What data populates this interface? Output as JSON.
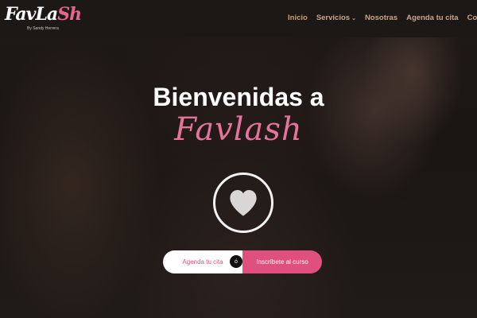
{
  "logo": {
    "word_main": "FavLa",
    "word_accent": "Sh",
    "tagline": "By Sandy Herrera"
  },
  "nav": {
    "items": [
      {
        "label": "Inicio"
      },
      {
        "label": "Servicios",
        "caret": "⌄"
      },
      {
        "label": "Nosotras"
      },
      {
        "label": "Agenda tu cita"
      },
      {
        "label": "Contac"
      }
    ]
  },
  "hero": {
    "title": "Bienvenidas a",
    "brand": "Favlash",
    "icon": "heart-icon",
    "cta_left": "Agenda tu cita",
    "cta_divider": "ó",
    "cta_right": "Inscríbete al curso"
  },
  "colors": {
    "accent_pink": "#e0507f",
    "brand_script": "#e6739b",
    "nav_text": "#c9a48a",
    "nav_active": "#d39a6e",
    "topbar": "#1c1816"
  }
}
